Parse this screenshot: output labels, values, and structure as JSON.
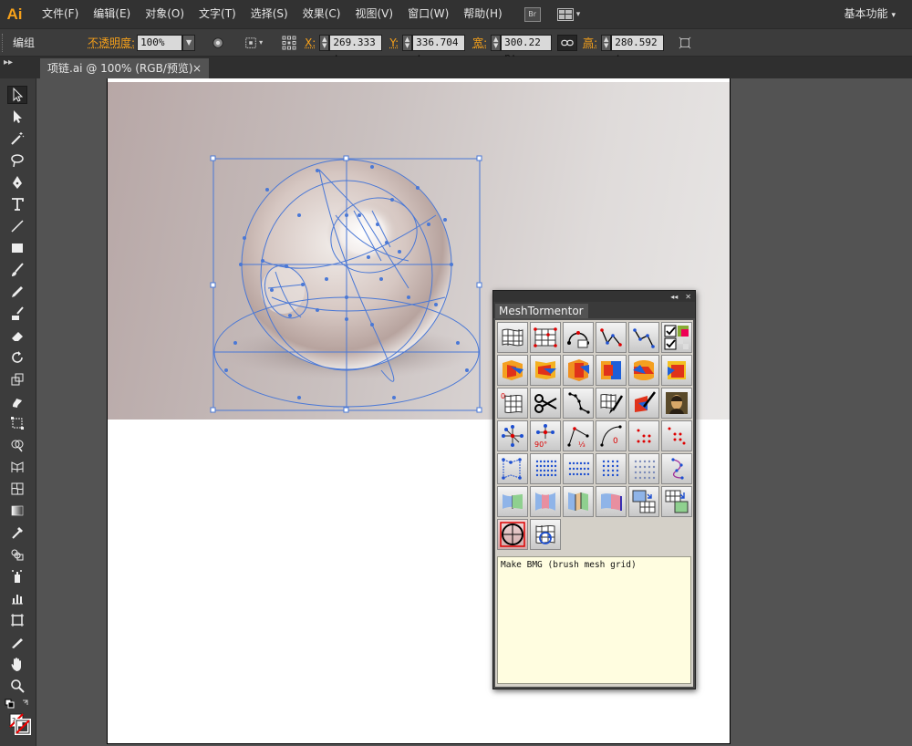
{
  "app": {
    "logo": "Ai",
    "workspace": "基本功能"
  },
  "menu": [
    "文件(F)",
    "编辑(E)",
    "对象(O)",
    "文字(T)",
    "选择(S)",
    "效果(C)",
    "视图(V)",
    "窗口(W)",
    "帮助(H)"
  ],
  "menu_extras": {
    "bridge": "Br"
  },
  "control": {
    "selection_type": "编组",
    "opacity_label": "不透明度:",
    "opacity_value": "100%",
    "x_label": "X:",
    "x_value": "269.333 :",
    "y_label": "Y:",
    "y_value": "336.704 :",
    "w_label": "宽:",
    "w_value": "300.22 p:",
    "h_label": "高:",
    "h_value": "280.592 :"
  },
  "document": {
    "tab_title": "项链.ai @ 100% (RGB/预览)",
    "close": "×"
  },
  "mesh_panel": {
    "title": "MeshTormentor",
    "help_text": "Make BMG (brush mesh grid)",
    "collapse": "◂◂",
    "close": "✕"
  },
  "colors": {
    "accent": "#f7a11a",
    "selection": "#4a78d6",
    "menubar": "#323232",
    "controlbar": "#3c3c3c",
    "help_bg": "#fffde0"
  }
}
